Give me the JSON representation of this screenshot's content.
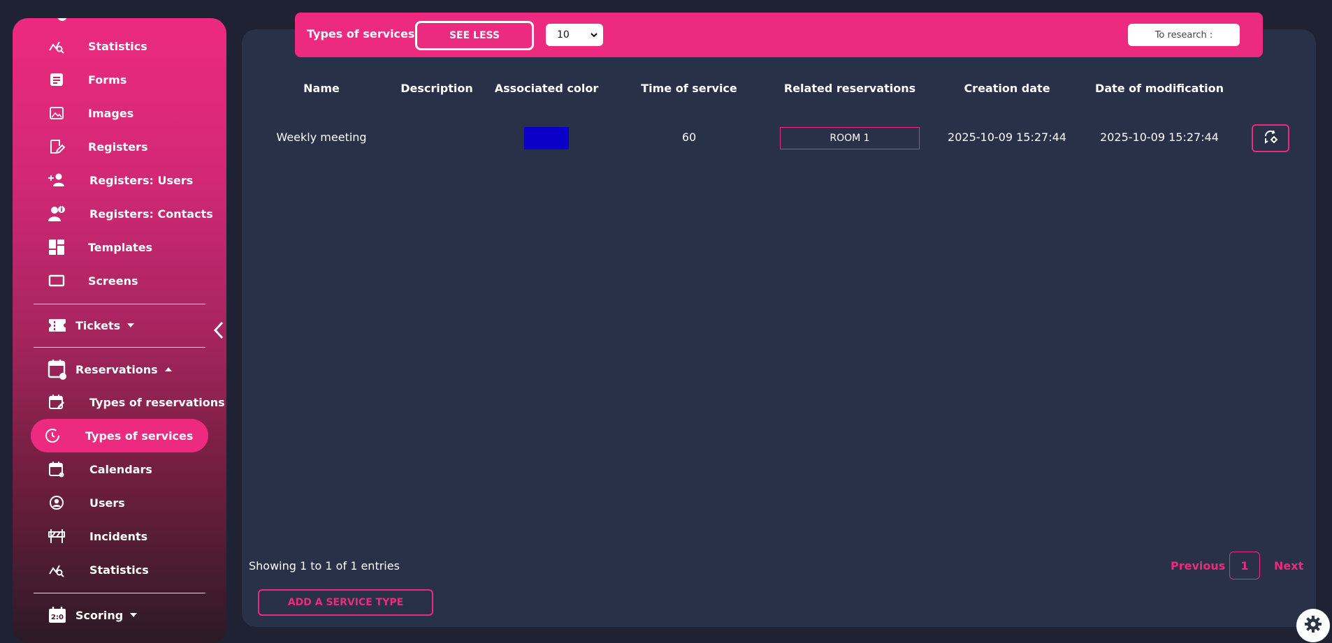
{
  "sidebar": {
    "items": [
      {
        "label": "Statistics",
        "icon": "chart-search-icon"
      },
      {
        "label": "Forms",
        "icon": "form-icon"
      },
      {
        "label": "Images",
        "icon": "image-icon"
      },
      {
        "label": "Registers",
        "icon": "register-edit-icon"
      },
      {
        "label": "Registers: Users",
        "icon": "user-add-icon"
      },
      {
        "label": "Registers: Contacts",
        "icon": "contact-info-icon"
      },
      {
        "label": "Templates",
        "icon": "templates-icon"
      },
      {
        "label": "Screens",
        "icon": "screen-icon"
      }
    ],
    "tickets": {
      "label": "Tickets",
      "icon": "ticket-icon"
    },
    "reservations": {
      "label": "Reservations",
      "icon": "calendar-dot-icon",
      "items": [
        {
          "label": "Types of reservations",
          "icon": "calendar-edit-icon"
        },
        {
          "label": "Types of services",
          "icon": "clock-icon",
          "active": true
        },
        {
          "label": "Calendars",
          "icon": "calendar-dot-icon"
        },
        {
          "label": "Users",
          "icon": "user-circle-icon"
        },
        {
          "label": "Incidents",
          "icon": "barrier-icon"
        },
        {
          "label": "Statistics",
          "icon": "chart-search-icon"
        }
      ]
    },
    "scoring": {
      "label": "Scoring",
      "icon": "scoreboard-icon"
    }
  },
  "toolbar": {
    "title": "Types of services",
    "see_less_label": "SEE LESS",
    "page_size": "10",
    "search_placeholder": "To research :"
  },
  "table": {
    "headers": [
      "Name",
      "Description",
      "Associated color",
      "Time of service",
      "Related reservations",
      "Creation date",
      "Date of modification"
    ],
    "rows": [
      {
        "name": "Weekly meeting",
        "description": "",
        "color": "#0a00c8",
        "time": "60",
        "related": "ROOM 1",
        "created": "2025-10-09 15:27:44",
        "modified": "2025-10-09 15:27:44"
      }
    ]
  },
  "footer": {
    "showing": "Showing 1 to 1 of 1 entries",
    "previous": "Previous",
    "page": "1",
    "next": "Next",
    "add_label": "ADD A SERVICE TYPE"
  },
  "colors": {
    "accent": "#ec2a7f",
    "panel": "#293149",
    "background": "#1e2233"
  }
}
